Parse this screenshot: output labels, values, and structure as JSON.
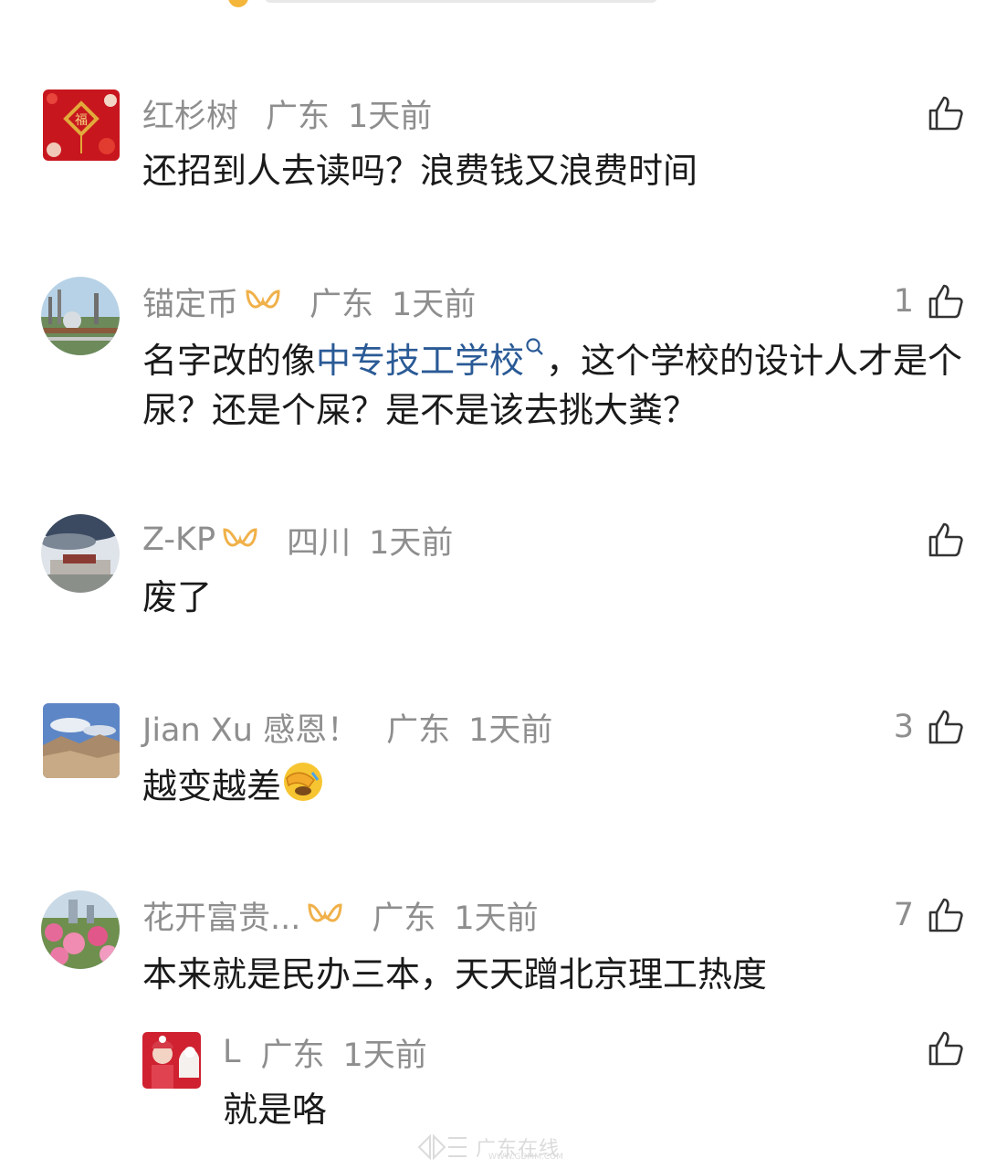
{
  "comments": [
    {
      "user": "红杉树",
      "region": "广东",
      "time": "1天前",
      "likes": "",
      "text": "还招到人去读吗？浪费钱又浪费时间"
    },
    {
      "user": "锚定币",
      "region": "广东",
      "time": "1天前",
      "likes": "1",
      "text_before": "名字改的像",
      "link": "中专技工学校",
      "text_after": "，这个学校的设计人才是个尿？还是个屎？是不是该去挑大粪？"
    },
    {
      "user": "Z-KP",
      "region": "四川",
      "time": "1天前",
      "likes": "",
      "text": "废了"
    },
    {
      "user": "Jian  Xu 感恩！",
      "region": "广东",
      "time": "1天前",
      "likes": "3",
      "text": "越变越差"
    },
    {
      "user": "花开富贵...",
      "region": "广东",
      "time": "1天前",
      "likes": "7",
      "text": "本来就是民办三本，天天蹭北京理工热度"
    }
  ],
  "reply": {
    "user": "L",
    "region": "广东",
    "time": "1天前",
    "likes": "",
    "text": "就是咯"
  },
  "watermark": {
    "text": "广东在线",
    "url": "WWW.GDMM.COM"
  },
  "colors": {
    "meta_gray": "#8e8e8e",
    "link_blue": "#2a5a96",
    "badge_gold": "#f0b14a"
  }
}
